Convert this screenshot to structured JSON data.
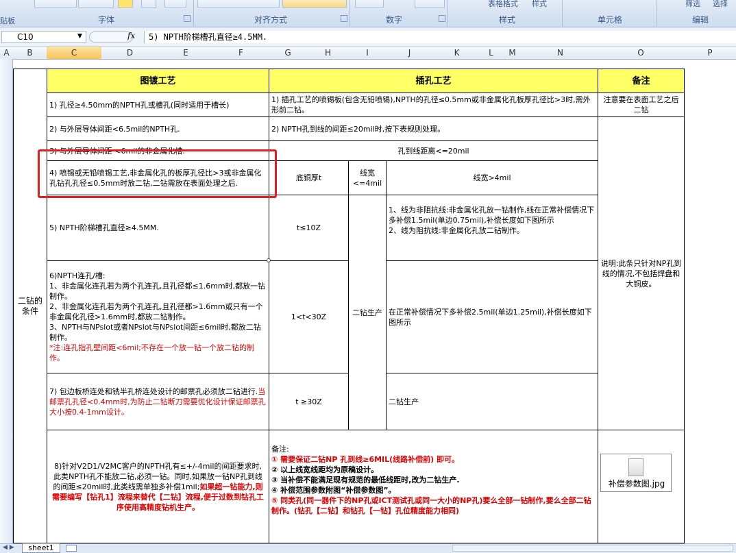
{
  "ribbon": {
    "groups": [
      "字体",
      "对齐方式",
      "数字",
      "样式",
      "单元格",
      "编辑"
    ],
    "left_label": "贴板",
    "buttons": [
      "表格格式",
      "样式",
      "筛选",
      "选择"
    ]
  },
  "formula_bar": {
    "name_box": "C10",
    "fx": "fx",
    "formula": "5) NPTH阶梯槽孔直径≥4.5MM."
  },
  "columns": [
    "A",
    "B",
    "C",
    "D",
    "E",
    "F",
    "G",
    "H",
    "I",
    "J",
    "K",
    "L",
    "M",
    "N",
    "O",
    "P"
  ],
  "table": {
    "hdr_plating": "图镀工艺",
    "hdr_plug": "插孔工艺",
    "hdr_remark": "备注",
    "side_label": "二钻的条件",
    "r1_left": "1) 孔径≥4.50mm的NPTH孔或槽孔(同时适用于槽长)",
    "r1_mid": "1) 插孔工艺的喷锡板(包含无铅喷锡),NPTH的孔径≤0.5mm或非金属化孔板厚孔径比>3时,需外形前二钻。",
    "r1_remark": "注意要在表面工艺之后二钻",
    "r2_left": "2) 与外层导体间距<6.5mil的NPTH孔.",
    "r2_mid": "2) NPTH孔到线的间距≤20mil时,按下表规则处理。",
    "r3_left": "3) 与外层导体间距 <6mil的非金属化槽.",
    "r3_mid": "孔到线距离<=20mil",
    "r4_left": "4) 喷锡或无铅喷锡工艺,非金属化孔的板厚孔径比>3或非金属化孔钻孔孔径≤0.5mm时放二钻,二钻需放在表面处理之后.",
    "sub_copper": "底铜厚t",
    "sub_lw_small": "线宽<=4mil",
    "sub_lw_big": "线宽>4mil",
    "r5_left": "5) NPTH阶梯槽孔直径≥4.5MM.",
    "r5_t": "t≤10Z",
    "r5_rule": "1、线为非阻抗线:非金属化孔放一钻制作,线在正常补偿情况下多补偿1.5mil(单边0.75mil),补偿长度如下图所示\n2、线为阻抗线:非金属化孔放二钻制作。",
    "r6_left_a": "6)NPTH连孔/槽:\n1、非金属化连孔若为两个孔连孔,且孔径都≤1.6mm时,都放一钻制作。\n2、非金属化连孔若为两个孔连孔,且孔径都>1.6mm或只有一个非金属化孔径>1.6mm时,都放二钻制作。\n3、NPTH与NPslot或者NPslot与NPslot间距≤6mil时,都放二钻制作。",
    "r6_left_note": "*注:连孔指孔壁间距<6mil;不存在一个放一钻一个放二钻的制作。",
    "r6_t": "1<t<30Z",
    "r6_drill2": "二钻生产",
    "r6_rule": "在正常补偿情况下多补偿2.5mil(单边1.25mil),补偿长度如下图所示",
    "r6_remark": "说明:此条只针对NP孔到线的情况,不包括焊盘和大铜皮。",
    "r7_left_a": "7) 包边板桥连处和铣半孔桥连处设计的邮票孔必须放二钻进行.",
    "r7_left_red": "当邮票孔孔径<0.4mm时,为防止二钻断刀需要优化设计保证邮票孔大小按0.4-1mm设计。",
    "r7_t": "t ≥30Z",
    "r7_rule": "二钻生产",
    "r8_left_a": "8)针对V2D1/V2MC客户的NPTH孔有≤+/-4mil的间距要求时,此类NPTH孔不能放二钻,必须一钻。同时,如果放一钻NP孔到线的间距≤20mil时,此类线需单独多补偿1mil;",
    "r8_left_red": "如果超一钻能力,则需要编写【钻孔1】流程来替代【二钻】流程,便于过数到钻孔工序使用高精度钻机生产。",
    "r8_note_title": "备注:",
    "r8_notes": [
      {
        "text": "① 需要保证二钻NP 孔到线≥6MIL(线路补偿前) 即可。",
        "color": "red"
      },
      {
        "text": "② 以上线宽线距均为原稿设计。",
        "color": "black"
      },
      {
        "text": "③ 当补偿不能满足现有规范的最低线距时,改为二钻生产.",
        "color": "black"
      },
      {
        "text": "④ 补偿范围参数附图“补偿参数图”。",
        "color": "black"
      },
      {
        "text": "⑤ 同类孔(同一器件下的NP孔或ICT测试孔或同一大小的NP孔)要么全部一钻制作,要么全部二钻制作。(钻孔【二钻】和钻孔【一钻】孔位精度能力相同)",
        "color": "red"
      }
    ],
    "attachment": "补偿参数图.jpg"
  },
  "sheet_tab": "sheet1",
  "colors": {
    "header_fill": "#ffff66",
    "highlight": "#e02020",
    "red_text": "#e00000"
  }
}
